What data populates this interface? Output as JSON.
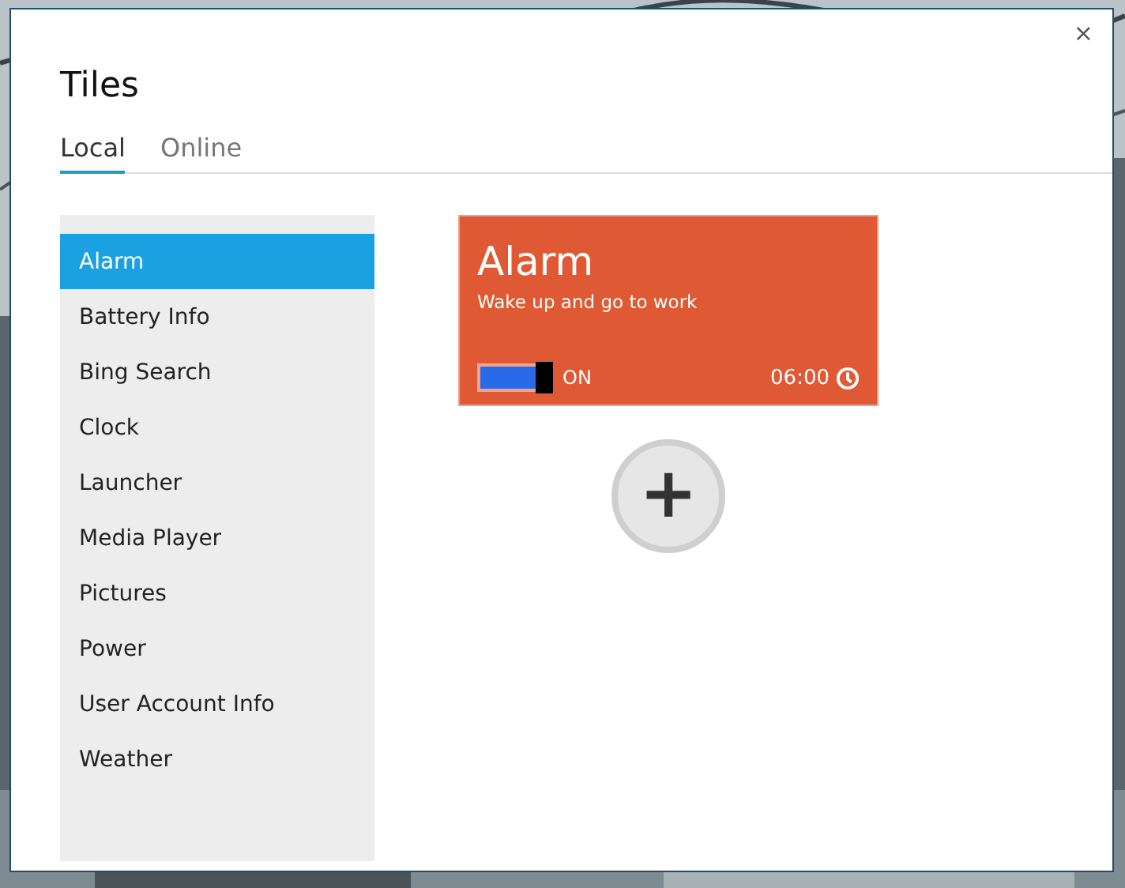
{
  "dialog": {
    "title": "Tiles",
    "close": "×"
  },
  "tabs": [
    {
      "label": "Local",
      "selected": true
    },
    {
      "label": "Online",
      "selected": false
    }
  ],
  "tile_list": [
    {
      "label": "Alarm",
      "selected": true
    },
    {
      "label": "Battery Info",
      "selected": false
    },
    {
      "label": "Bing Search",
      "selected": false
    },
    {
      "label": "Clock",
      "selected": false
    },
    {
      "label": "Launcher",
      "selected": false
    },
    {
      "label": "Media Player",
      "selected": false
    },
    {
      "label": "Pictures",
      "selected": false
    },
    {
      "label": "Power",
      "selected": false
    },
    {
      "label": "User Account Info",
      "selected": false
    },
    {
      "label": "Weather",
      "selected": false
    }
  ],
  "preview_tile": {
    "title": "Alarm",
    "subtitle": "Wake up and go to work",
    "on": true,
    "state_label": "ON",
    "time": "06:00"
  },
  "add_button": {
    "label": "+"
  }
}
